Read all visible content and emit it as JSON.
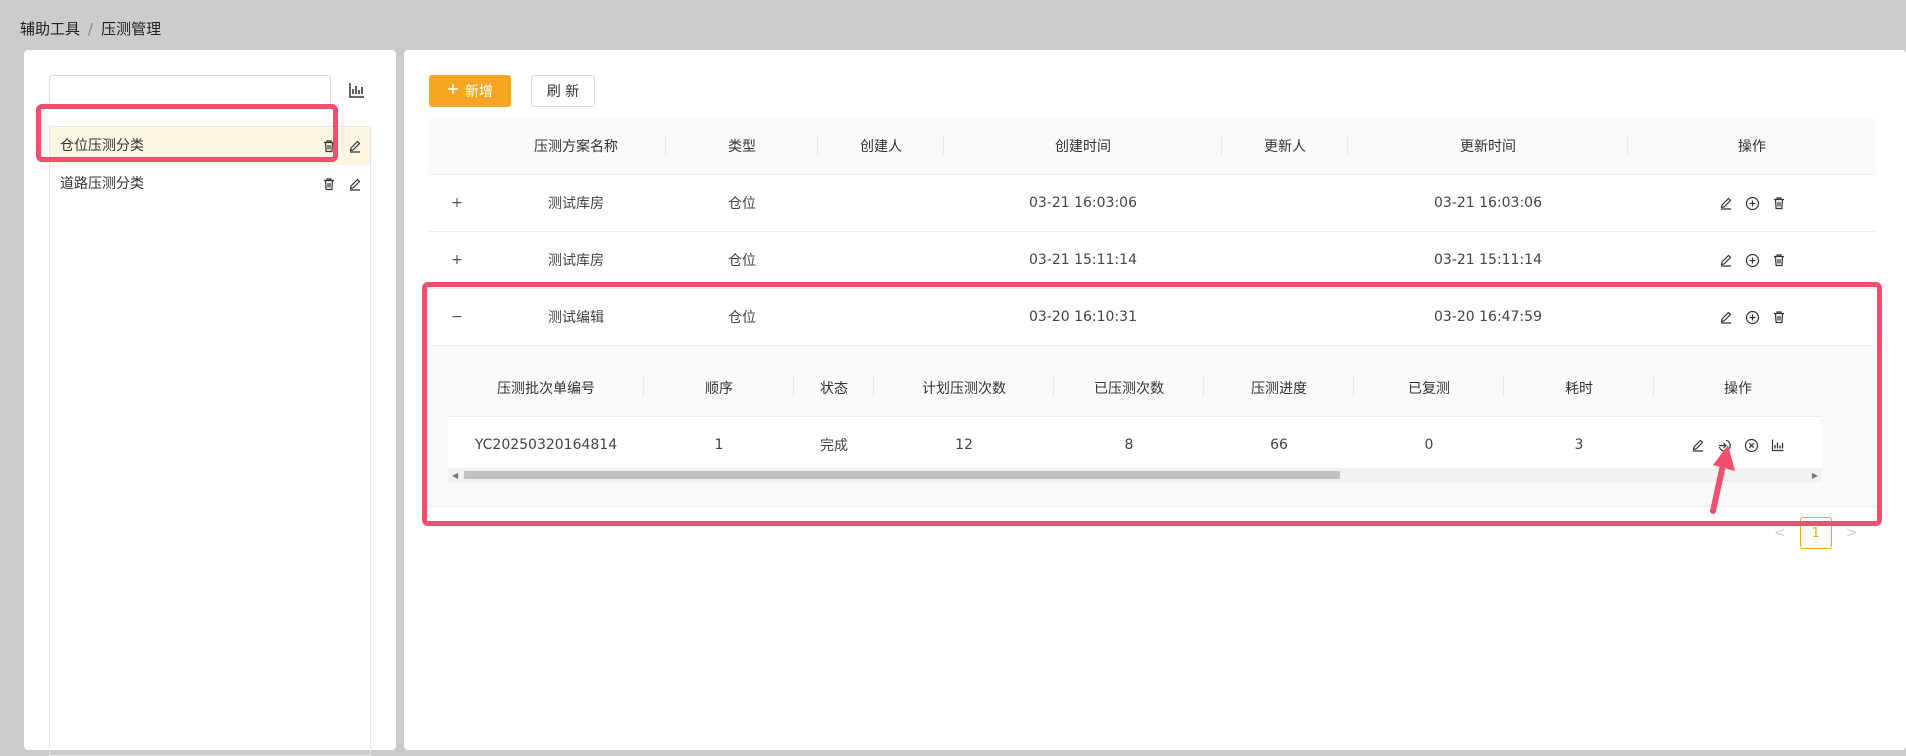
{
  "breadcrumb": {
    "root": "辅助工具",
    "separator": "/",
    "current": "压测管理"
  },
  "sidebar": {
    "search": {
      "value": "",
      "placeholder": ""
    },
    "chart_icon": "bar-chart-icon",
    "items": [
      {
        "label": "仓位压测分类",
        "active": true
      },
      {
        "label": "道路压测分类",
        "active": false
      }
    ]
  },
  "toolbar": {
    "add_label": "新增",
    "refresh_label": "刷 新"
  },
  "main_table": {
    "columns": [
      "",
      "压测方案名称",
      "类型",
      "创建人",
      "创建时间",
      "更新人",
      "更新时间",
      "操作"
    ],
    "rows": [
      {
        "expander": "+",
        "name": "测试库房",
        "type": "仓位",
        "creator": "",
        "created": "03-21 16:03:06",
        "updater": "",
        "updated": "03-21 16:03:06"
      },
      {
        "expander": "+",
        "name": "测试库房",
        "type": "仓位",
        "creator": "",
        "created": "03-21 15:11:14",
        "updater": "",
        "updated": "03-21 15:11:14"
      },
      {
        "expander": "−",
        "name": "测试编辑",
        "type": "仓位",
        "creator": "",
        "created": "03-20 16:10:31",
        "updater": "",
        "updated": "03-20 16:47:59"
      }
    ]
  },
  "sub_table": {
    "columns": [
      "压测批次单编号",
      "顺序",
      "状态",
      "计划压测次数",
      "已压测次数",
      "压测进度",
      "已复测",
      "耗时",
      "操作"
    ],
    "rows": [
      {
        "batch_no": "YC20250320164814",
        "order": "1",
        "status": "完成",
        "planned": "12",
        "done": "8",
        "progress": "66",
        "retested": "0",
        "duration": "3"
      }
    ]
  },
  "pagination": {
    "prev": "<",
    "current": "1",
    "next": ">"
  },
  "colors": {
    "accent": "#f5a623",
    "annotation": "#f0506e",
    "active_row": "#fdf7e4"
  }
}
